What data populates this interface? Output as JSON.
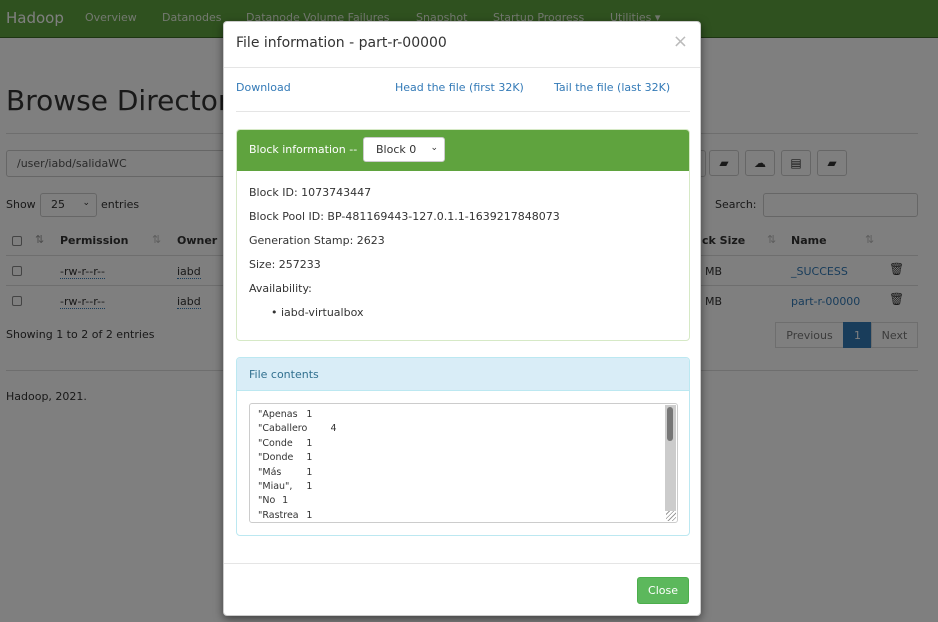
{
  "navbar": {
    "brand": "Hadoop",
    "items": [
      "Overview",
      "Datanodes",
      "Datanode Volume Failures",
      "Snapshot",
      "Startup Progress",
      "Utilities"
    ],
    "dropdown_caret": "▾"
  },
  "page": {
    "title": "Browse Directory",
    "path": "/user/iabd/salidaWC",
    "toolbar_icons": [
      "folder-open-icon",
      "upload-icon",
      "list-icon",
      "create-folder-icon"
    ],
    "show_label": "Show",
    "entries_per_page": "25",
    "entries_label": "entries",
    "search_label": "Search:",
    "search_value": "",
    "columns": [
      "Permission",
      "Owner",
      "Block Size",
      "Name"
    ],
    "column_partial": {
      "block_size": "ck Size"
    },
    "rows": [
      {
        "permission": "-rw-r--r--",
        "owner": "iabd",
        "block_size": "MB",
        "name": "_SUCCESS"
      },
      {
        "permission": "-rw-r--r--",
        "owner": "iabd",
        "block_size": "MB",
        "name": "part-r-00000"
      }
    ],
    "showing": "Showing 1 to 2 of 2 entries",
    "pagination": {
      "previous": "Previous",
      "current": "1",
      "next": "Next"
    },
    "footer": "Hadoop, 2021."
  },
  "modal": {
    "title": "File information - part-r-00000",
    "close_symbol": "×",
    "links": {
      "download": "Download",
      "head": "Head the file (first 32K)",
      "tail": "Tail the file (last 32K)"
    },
    "block_panel": {
      "label": "Block information --",
      "selected_block": "Block 0",
      "block_id": "Block ID: 1073743447",
      "block_pool_id": "Block Pool ID: BP-481169443-127.0.1.1-1639217848073",
      "generation_stamp": "Generation Stamp: 2623",
      "size": "Size: 257233",
      "availability_label": "Availability:",
      "availability": [
        "iabd-virtualbox"
      ]
    },
    "contents_panel": {
      "label": "File contents",
      "lines": [
        "\"Apenas\t1",
        "\"Caballero\t4",
        "\"Conde\t1",
        "\"Donde\t1",
        "\"Más\t1",
        "\"Miau\",\t1",
        "\"No\t1",
        "\"Rastrea\t1"
      ]
    },
    "close_button": "Close"
  }
}
